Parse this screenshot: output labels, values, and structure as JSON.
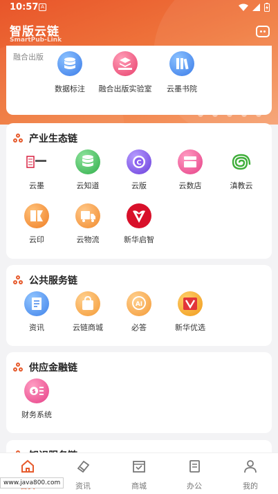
{
  "status_bar": {
    "time": "10:57",
    "notif_letter": "A"
  },
  "header": {
    "title": "智版云链",
    "subtitle": "SmartPub-Link",
    "message_icon": "chat-bubble-icon"
  },
  "top_card": {
    "partial_text": "融合出版",
    "items": [
      {
        "label": "数据标注",
        "icon": "database-icon",
        "color": "#4a8ff0"
      },
      {
        "label": "融合出版实验室",
        "icon": "layers-hand-icon",
        "color": "#ef4f79"
      },
      {
        "label": "云墨书院",
        "icon": "books-icon",
        "color": "#4a8ff0"
      }
    ]
  },
  "sections": [
    {
      "title": "产业生态链",
      "items": [
        {
          "label": "云墨",
          "icon": "yunmo-logo-icon",
          "color": "#ffffff"
        },
        {
          "label": "云知道",
          "icon": "database-stack-icon",
          "color": "#3fbf5a"
        },
        {
          "label": "云版",
          "icon": "copyright-c-icon",
          "color": "#7b4fe0"
        },
        {
          "label": "云数店",
          "icon": "store-icon",
          "color": "#ef4f8f"
        },
        {
          "label": "滇教云",
          "icon": "swirl-logo-icon",
          "color": "#ffffff"
        },
        {
          "label": "云印",
          "icon": "print-book-icon",
          "color": "#f38c2e"
        },
        {
          "label": "云物流",
          "icon": "delivery-truck-icon",
          "color": "#f59a3a"
        },
        {
          "label": "新华启智",
          "icon": "xinhua-logo-icon",
          "color": "#d8102a"
        }
      ]
    },
    {
      "title": "公共服务链",
      "items": [
        {
          "label": "资讯",
          "icon": "news-icon",
          "color": "#4a8ff0"
        },
        {
          "label": "云链商城",
          "icon": "shopping-bag-icon",
          "color": "#f7a23c"
        },
        {
          "label": "必答",
          "icon": "ai-head-icon",
          "color": "#f7a23c"
        },
        {
          "label": "新华优选",
          "icon": "xinhua-select-icon",
          "color": "#e2353a"
        }
      ]
    },
    {
      "title": "供应金融链",
      "items": [
        {
          "label": "财务系统",
          "icon": "finance-dollar-icon",
          "color": "#ef4f8f"
        }
      ]
    },
    {
      "title": "知识服务链",
      "items": []
    }
  ],
  "bottom_nav": [
    {
      "label": "首页",
      "icon": "home-icon",
      "active": true
    },
    {
      "label": "资讯",
      "icon": "news-tab-icon",
      "active": false
    },
    {
      "label": "商城",
      "icon": "store-tab-icon",
      "active": false
    },
    {
      "label": "办公",
      "icon": "office-tab-icon",
      "active": false
    },
    {
      "label": "我的",
      "icon": "profile-icon",
      "active": false
    }
  ],
  "watermark": "www.java800.com",
  "colors": {
    "accent": "#e65a2c",
    "background": "#f3f3f5"
  }
}
